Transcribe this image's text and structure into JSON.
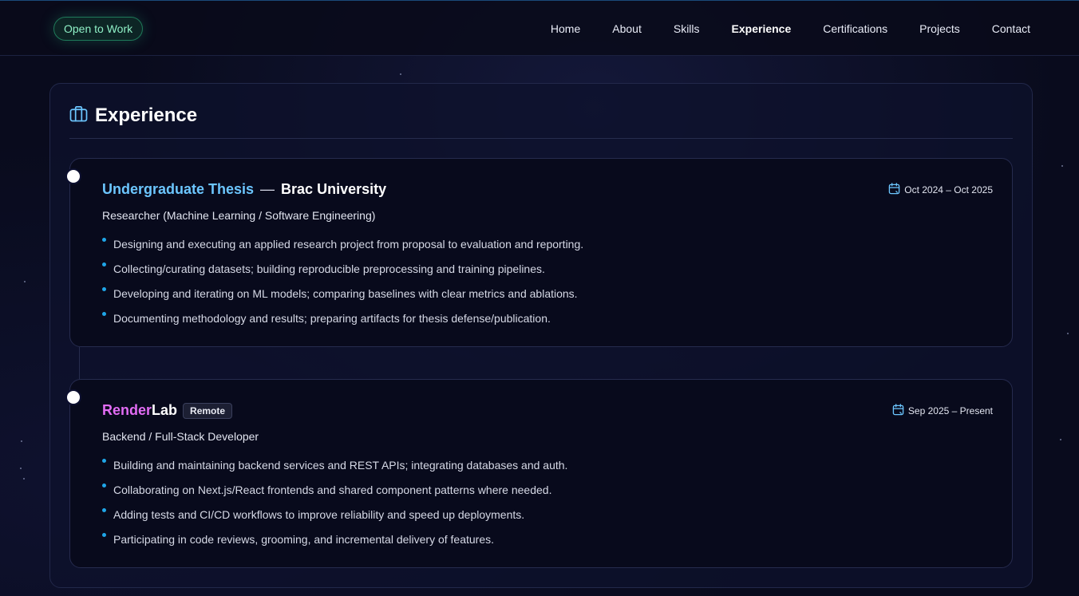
{
  "header": {
    "badge": "Open to Work",
    "nav": [
      "Home",
      "About",
      "Skills",
      "Experience",
      "Certifications",
      "Projects",
      "Contact"
    ],
    "active": "Experience"
  },
  "section": {
    "title": "Experience",
    "icon": "briefcase-icon"
  },
  "experience": [
    {
      "title": "Undergraduate Thesis",
      "separator": "—",
      "org": "Brac University",
      "date": "Oct 2024 – Oct 2025",
      "role": "Researcher (Machine Learning / Software Engineering)",
      "bullets": [
        "Designing and executing an applied research project from proposal to evaluation and reporting.",
        "Collecting/curating datasets; building reproducible preprocessing and training pipelines.",
        "Developing and iterating on ML models; comparing baselines with clear metrics and ablations.",
        "Documenting methodology and results; preparing artifacts for thesis defense/publication."
      ]
    },
    {
      "title_part1": "Render",
      "title_part2": "Lab",
      "tag": "Remote",
      "date": "Sep 2025 – Present",
      "role": "Backend / Full-Stack Developer",
      "bullets": [
        "Building and maintaining backend services and REST APIs; integrating databases and auth.",
        "Collaborating on Next.js/React frontends and shared component patterns where needed.",
        "Adding tests and CI/CD workflows to improve reliability and speed up deployments.",
        "Participating in code reviews, grooming, and incremental delivery of features."
      ]
    }
  ],
  "colors": {
    "background": "#090b1d",
    "accent_blue": "#6cc6ff",
    "accent_pink": "#e26cf4",
    "badge_green": "#8ff0c6",
    "bullet": "#1fa6e8"
  }
}
